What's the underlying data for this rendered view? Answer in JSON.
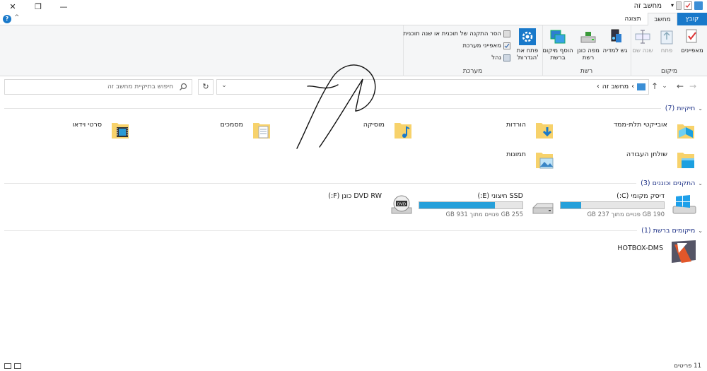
{
  "window": {
    "title": "מחשב זה",
    "minimize_glyph": "—",
    "maximize_glyph": "❐",
    "close_glyph": "✕"
  },
  "ribbon_tabs": {
    "file": "קובץ",
    "computer": "מחשב",
    "view": "תצוגה",
    "help_glyph": "?",
    "collapse_glyph": "^"
  },
  "ribbon": {
    "location_group": {
      "caption": "מיקום",
      "properties": "מאפיינים",
      "open": "פתח",
      "rename": "שנה שם"
    },
    "network_group": {
      "caption": "רשת",
      "access_media": "גש למדיה",
      "map_drive": "מפה כונן רשת",
      "add_location": "הוסף מיקום ברשת"
    },
    "system_group": {
      "caption": "מערכת",
      "open_settings": "פתח את 'הגדרות'",
      "uninstall": "הסר התקנה של תוכנית או שנה תוכנית",
      "system_properties": "מאפייני מערכת",
      "manage": "נהל"
    }
  },
  "address_bar": {
    "crumb": "מחשב זה",
    "separator": "›",
    "dropdown_glyph": "⌄",
    "refresh_glyph": "↻",
    "back_glyph": "←",
    "forward_glyph": "→",
    "recent_glyph": "⌄",
    "up_glyph": "↑",
    "search_placeholder": "חיפוש בתיקיית מחשב זה"
  },
  "sections": {
    "folders": "תיקיות (7)",
    "devices": "התקנים וכוננים (3)",
    "network": "מיקומים ברשת (1)",
    "chevron": "⌄"
  },
  "folders": [
    {
      "name": "אובייקטי תלת-ממד",
      "icon": "3d-objects-folder-icon"
    },
    {
      "name": "הורדות",
      "icon": "downloads-folder-icon"
    },
    {
      "name": "מוסיקה",
      "icon": "music-folder-icon"
    },
    {
      "name": "מסמכים",
      "icon": "documents-folder-icon"
    },
    {
      "name": "סרטי וידאו",
      "icon": "videos-folder-icon"
    },
    {
      "name": "שולחן העבודה",
      "icon": "desktop-folder-icon"
    },
    {
      "name": "תמונות",
      "icon": "pictures-folder-icon"
    }
  ],
  "drives": [
    {
      "name": "דיסק מקומי (C:)",
      "free": "190 GB פנויים מתוך 237 GB",
      "used_fraction": 0.2,
      "icon": "windows-drive-icon"
    },
    {
      "name": "SSD חיצוני (E:)",
      "free": "255 GB פנויים מתוך 931 GB",
      "used_fraction": 0.73,
      "icon": "external-drive-icon"
    },
    {
      "name": "DVD RW כונן (F:)",
      "icon": "dvd-drive-icon"
    }
  ],
  "network_locations": [
    {
      "name": "HOTBOX-DMS",
      "icon": "media-server-icon"
    }
  ],
  "status": {
    "items": "11 פריטים"
  },
  "colors": {
    "accent": "#1979ca",
    "drive_fill": "#26a0da",
    "section_text": "#1e3287",
    "folder_yellow": "#f7d26b"
  }
}
